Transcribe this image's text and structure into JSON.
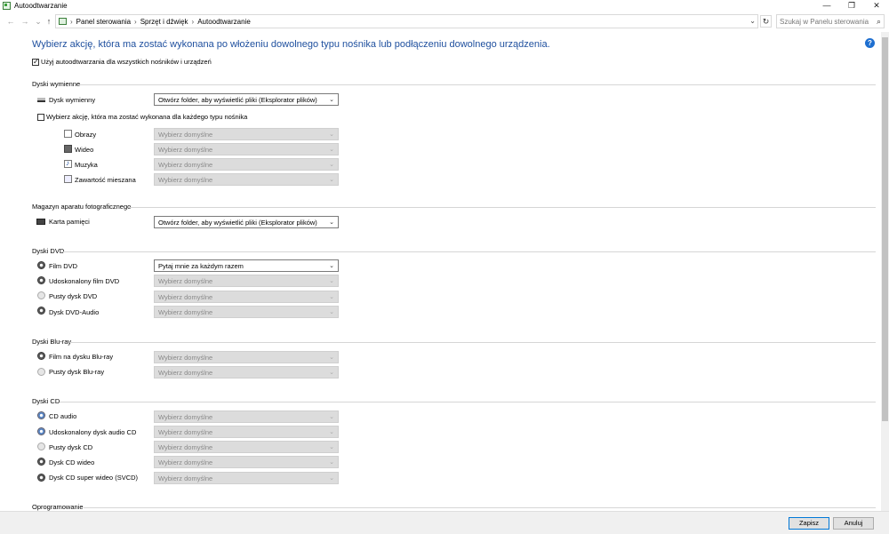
{
  "window": {
    "title": "Autoodtwarzanie",
    "minimize_glyph": "—",
    "restore_glyph": "❐",
    "close_glyph": "✕"
  },
  "address": {
    "back_glyph": "←",
    "forward_glyph": "→",
    "recent_glyph": "⌄",
    "up_glyph": "↑",
    "separator": "›",
    "crumbs": [
      "Panel sterowania",
      "Sprzęt i dźwięk",
      "Autoodtwarzanie"
    ],
    "dropdown_glyph": "⌄",
    "refresh_glyph": "↻",
    "search_placeholder": "Szukaj w Panelu sterowania",
    "search_glyph": "⌕"
  },
  "main": {
    "headline": "Wybierz akcję, która ma zostać wykonana po włożeniu dowolnego typu nośnika lub podłączeniu dowolnego urządzenia.",
    "help_glyph": "?",
    "use_autoplay_label": "Użyj autoodtwarzania dla wszystkich nośników i urządzeń",
    "use_autoplay_checked": true
  },
  "sections": {
    "removable": {
      "title": "Dyski wymienne",
      "drive_label": "Dysk wymienny",
      "drive_value": "Otwórz folder, aby wyświetlić pliki (Eksplorator plików)",
      "per_type_label": "Wybierz akcję, która ma zostać wykonana dla każdego typu nośnika",
      "per_type_checked": false,
      "items": [
        {
          "label": "Obrazy",
          "value": "Wybierz domyślne"
        },
        {
          "label": "Wideo",
          "value": "Wybierz domyślne"
        },
        {
          "label": "Muzyka",
          "value": "Wybierz domyślne"
        },
        {
          "label": "Zawartość mieszana",
          "value": "Wybierz domyślne"
        }
      ]
    },
    "camera": {
      "title": "Magazyn aparatu fotograficznego",
      "items": [
        {
          "label": "Karta pamięci",
          "value": "Otwórz folder, aby wyświetlić pliki (Eksplorator plików)"
        }
      ]
    },
    "dvd": {
      "title": "Dyski DVD",
      "items": [
        {
          "label": "Film DVD",
          "value": "Pytaj mnie za każdym razem"
        },
        {
          "label": "Udoskonalony film DVD",
          "value": "Wybierz domyślne"
        },
        {
          "label": "Pusty dysk DVD",
          "value": "Wybierz domyślne"
        },
        {
          "label": "Dysk DVD-Audio",
          "value": "Wybierz domyślne"
        }
      ]
    },
    "bluray": {
      "title": "Dyski Blu-ray",
      "items": [
        {
          "label": "Film na dysku Blu-ray",
          "value": "Wybierz domyślne"
        },
        {
          "label": "Pusty dysk Blu-ray",
          "value": "Wybierz domyślne"
        }
      ]
    },
    "cd": {
      "title": "Dyski CD",
      "items": [
        {
          "label": "CD audio",
          "value": "Wybierz domyślne"
        },
        {
          "label": "Udoskonalony dysk audio CD",
          "value": "Wybierz domyślne"
        },
        {
          "label": "Pusty dysk CD",
          "value": "Wybierz domyślne"
        },
        {
          "label": "Dysk CD wideo",
          "value": "Wybierz domyślne"
        },
        {
          "label": "Dysk CD super wideo (SVCD)",
          "value": "Wybierz domyślne"
        }
      ]
    },
    "software": {
      "title": "Oprogramowanie"
    }
  },
  "chevron_glyph": "⌄",
  "footer": {
    "save_label": "Zapisz",
    "cancel_label": "Anuluj"
  }
}
